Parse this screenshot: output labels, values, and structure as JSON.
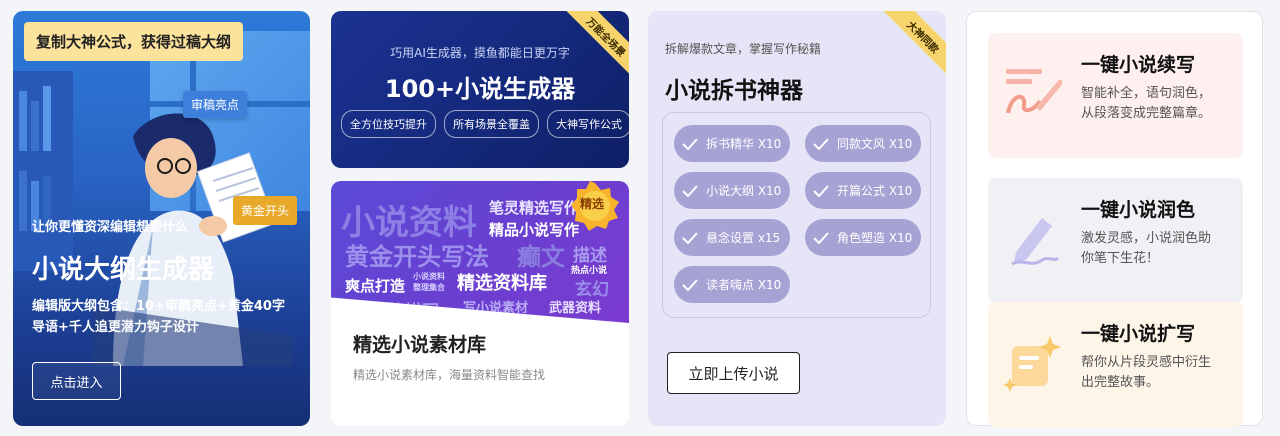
{
  "card_outline": {
    "badge": "复制大神公式，获得过稿大纲",
    "tag_review": "审稿亮点",
    "tag_gold": "黄金开头",
    "subtitle": "让你更懂资深编辑想要什么",
    "title": "小说大纲生成器",
    "description": "编辑版大纲包含：10+审稿亮点+黄金40字导语+千人追更潜力钩子设计",
    "button": "点击进入"
  },
  "card_generator": {
    "ribbon": "万能全场景",
    "subtitle": "巧用AI生成器，摸鱼都能日更万字",
    "title": "100+小说生成器",
    "chips": [
      "全方位技巧提升",
      "所有场景全覆盖",
      "大神写作公式"
    ]
  },
  "card_library": {
    "medal": "精选",
    "banner_words": [
      "小说资料",
      "笔灵精选写作",
      "精品小说写作",
      "黄金开头写法",
      "癫文",
      "描述",
      "爽点打造",
      "小说资料",
      "整理集合",
      "精选资料库",
      "热点小说",
      "玄幻",
      "人物性格描写",
      "写小说素材",
      "武器资料"
    ],
    "title": "精选小说素材库",
    "description": "精选小说素材库，海量资料智能查找"
  },
  "card_breakdown": {
    "ribbon": "大神同款",
    "subtitle": "拆解爆款文章，掌握写作秘籍",
    "title": "小说拆书神器",
    "pills": [
      "拆书精华 X10",
      "同款文风 X10",
      "小说大纲 X10",
      "开篇公式 X10",
      "悬念设置 x15",
      "角色塑造 X10",
      "读者嗨点 X10"
    ],
    "button": "立即上传小说"
  },
  "card_features": {
    "items": [
      {
        "title": "一键小说续写",
        "desc": "智能补全，语句润色，从段落变成完整篇章。",
        "bg": "#fdf0ee",
        "icon": "quill-icon"
      },
      {
        "title": "一键小说润色",
        "desc": "激发灵感，小说润色助你笔下生花！",
        "bg": "#f0f0f5",
        "icon": "pen-icon"
      },
      {
        "title": "一键小说扩写",
        "desc": "帮你从片段灵感中衍生出完整故事。",
        "bg": "#fdf5e8",
        "icon": "sparkle-note-icon"
      }
    ]
  },
  "colors": {
    "outline_bg": "#2a64c4",
    "generator_bg": "#152a7e",
    "library_banner": "#6a3fd0",
    "breakdown_bg": "#e6e5f7",
    "pill": "#a7a2d4",
    "ribbon": "#f6d46b",
    "badge": "#fbe39c"
  }
}
